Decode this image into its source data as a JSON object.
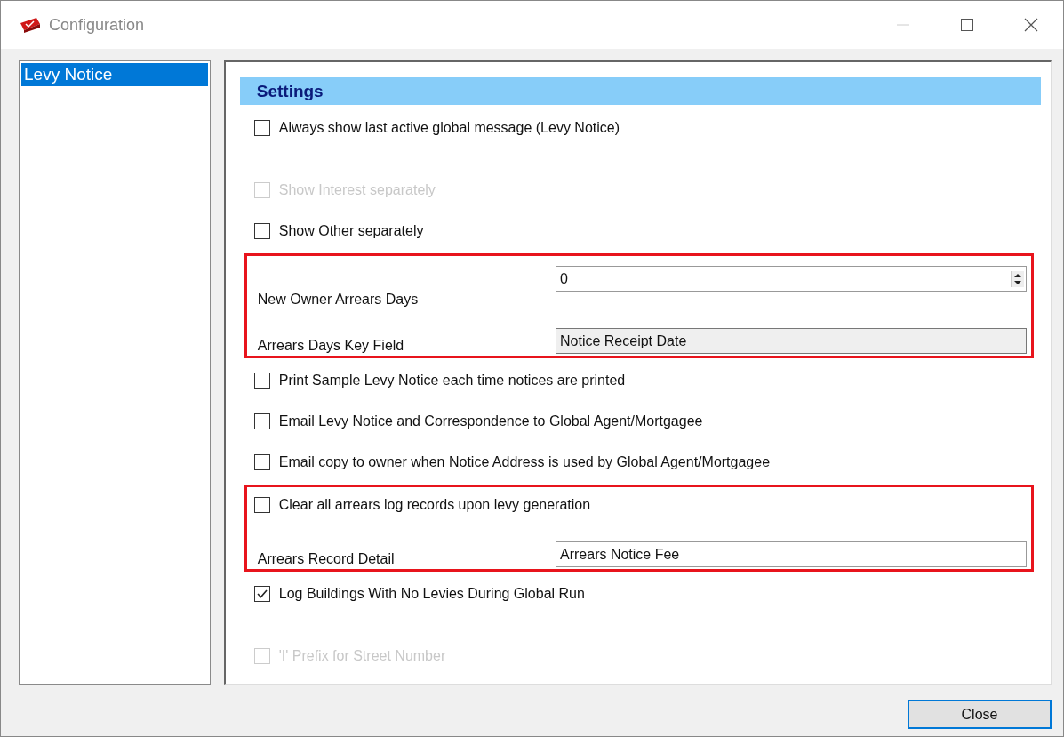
{
  "window": {
    "title": "Configuration"
  },
  "sidebar": {
    "items": [
      {
        "label": "Levy Notice",
        "selected": true
      }
    ]
  },
  "settings": {
    "title": "Settings",
    "items": [
      {
        "kind": "checkbox",
        "label": "Always show last active global message (Levy Notice)",
        "checked": false,
        "faded": false
      },
      {
        "kind": "checkbox",
        "label": "Show Interest separately",
        "checked": false,
        "faded": true
      },
      {
        "kind": "checkbox",
        "label": "Show Other separately",
        "checked": false,
        "faded": false
      },
      {
        "kind": "group",
        "highlighted": true,
        "children": [
          {
            "kind": "spin",
            "label": "New Owner Arrears Days",
            "value": "0"
          },
          {
            "kind": "readonly",
            "label": "Arrears Days Key Field",
            "value": "Notice Receipt Date"
          }
        ]
      },
      {
        "kind": "checkbox",
        "label": "Print Sample Levy Notice each time notices are printed",
        "checked": false,
        "faded": false
      },
      {
        "kind": "checkbox",
        "label": "Email Levy Notice and Correspondence to Global Agent/Mortgagee",
        "checked": false,
        "faded": false
      },
      {
        "kind": "checkbox",
        "label": "Email copy to owner when Notice Address is used by Global Agent/Mortgagee",
        "checked": false,
        "faded": false
      },
      {
        "kind": "group",
        "highlighted": true,
        "children": [
          {
            "kind": "checkbox",
            "label": "Clear all arrears log records upon levy generation",
            "checked": false,
            "faded": false
          },
          {
            "kind": "text",
            "label": "Arrears Record Detail",
            "value": "Arrears Notice Fee"
          }
        ]
      },
      {
        "kind": "checkbox",
        "label": "Log Buildings With No Levies During Global Run",
        "checked": true,
        "faded": false
      },
      {
        "kind": "checkbox",
        "label": "'I' Prefix for Street Number",
        "checked": false,
        "faded": true
      }
    ]
  },
  "buttons": [
    {
      "label": "Close"
    }
  ]
}
